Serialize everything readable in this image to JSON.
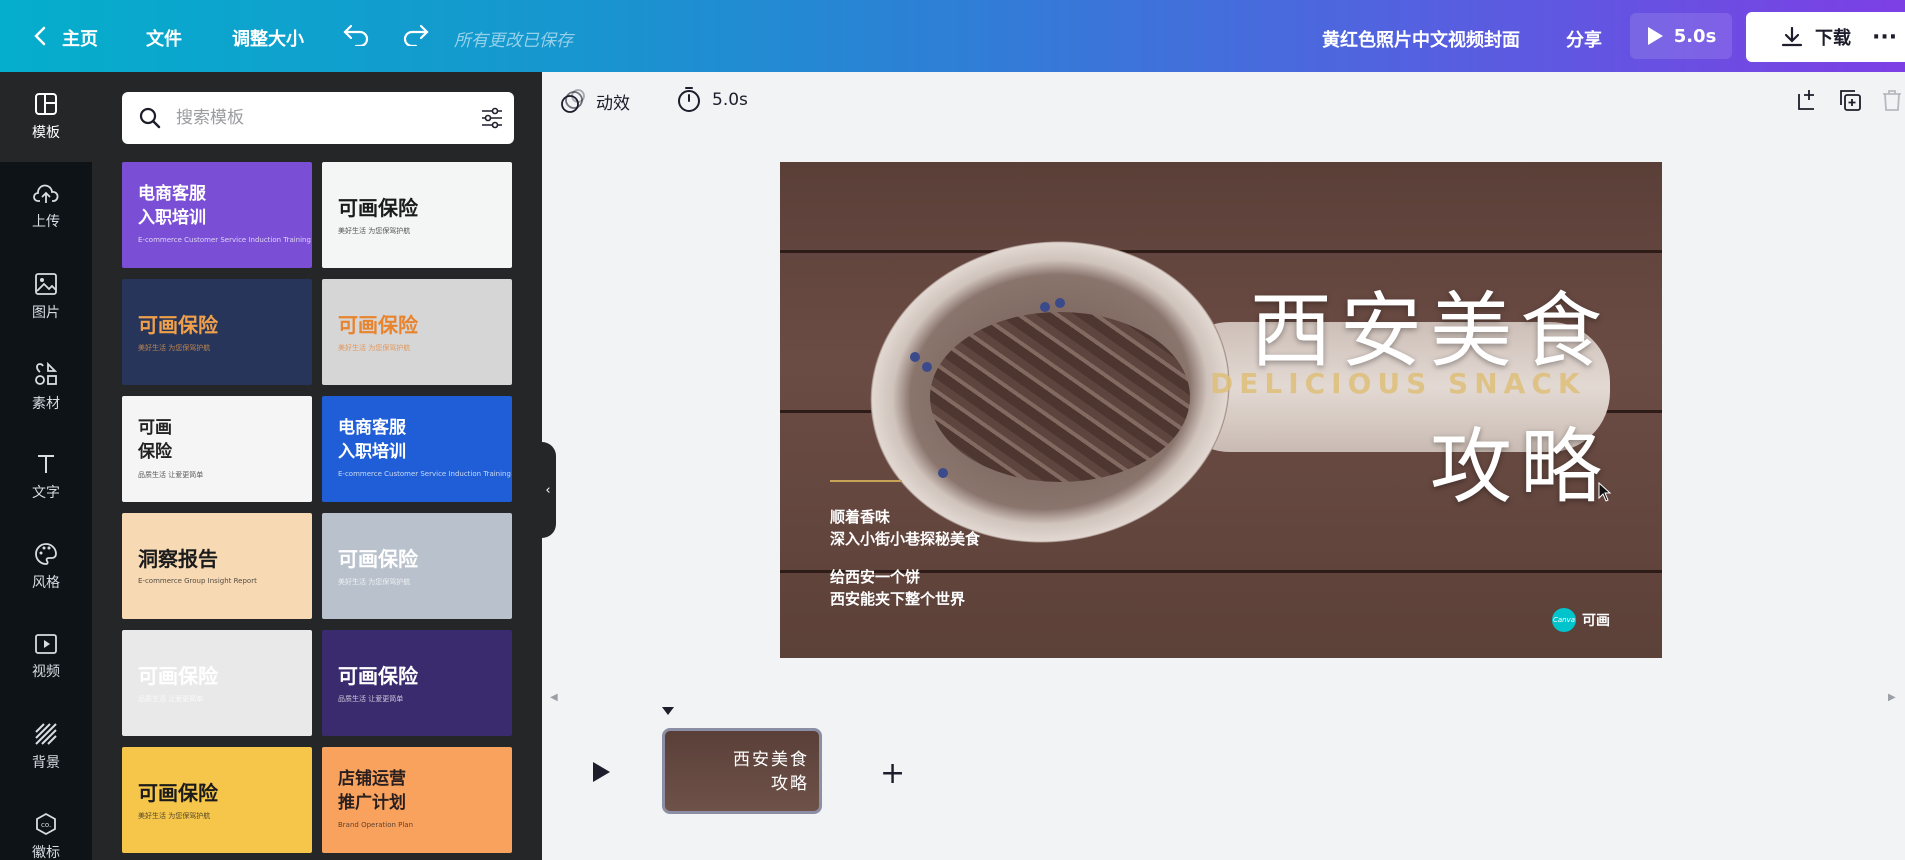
{
  "topbar": {
    "home": "主页",
    "file": "文件",
    "resize": "调整大小",
    "saved_status": "所有更改已保存",
    "doc_title": "黄红色照片中文视频封面",
    "share": "分享",
    "play_duration": "5.0s",
    "download": "下载"
  },
  "rail": {
    "items": [
      {
        "label": "模板",
        "icon": "template-icon"
      },
      {
        "label": "上传",
        "icon": "upload-icon"
      },
      {
        "label": "图片",
        "icon": "photo-icon"
      },
      {
        "label": "素材",
        "icon": "elements-icon"
      },
      {
        "label": "文字",
        "icon": "text-icon"
      },
      {
        "label": "风格",
        "icon": "palette-icon"
      },
      {
        "label": "视频",
        "icon": "video-icon"
      },
      {
        "label": "背景",
        "icon": "background-icon"
      },
      {
        "label": "徽标",
        "icon": "logo-icon"
      }
    ]
  },
  "panel": {
    "search_placeholder": "搜索模板",
    "templates": [
      {
        "title": "电商客服\n入职培训",
        "subtitle": "E-commerce Customer Service Induction Training",
        "bg": "#7a4fd6",
        "fg": "#ffffff"
      },
      {
        "title": "可画保险",
        "subtitle": "美好生活 为您保驾护航",
        "bg": "#f4f5f5",
        "fg": "#1b1b1b"
      },
      {
        "title": "可画保险",
        "subtitle": "美好生活 为您保驾护航",
        "bg": "#27355a",
        "fg": "#f0a04b"
      },
      {
        "title": "可画保险",
        "subtitle": "美好生活 为您保驾护航",
        "bg": "#d6d6d6",
        "fg": "#e8832e"
      },
      {
        "title": "可画\n保险",
        "subtitle": "品质生活 让爱更简单",
        "bg": "#f5f5f5",
        "fg": "#222222"
      },
      {
        "title": "电商客服\n入职培训",
        "subtitle": "E-commerce Customer Service Induction Training",
        "bg": "#1f5ed6",
        "fg": "#ffffff"
      },
      {
        "title": "洞察报告",
        "subtitle": "E-commerce Group Insight Report",
        "bg": "#f7d9b4",
        "fg": "#1b1b1b"
      },
      {
        "title": "可画保险",
        "subtitle": "美好生活 为您保驾护航",
        "bg": "#b9c2cc",
        "fg": "#ffffff"
      },
      {
        "title": "可画保险",
        "subtitle": "品质生活 让爱更简单",
        "bg": "#e9e9e9",
        "fg": "#ffffff"
      },
      {
        "title": "可画保险",
        "subtitle": "品质生活 让爱更简单",
        "bg": "#3a2a6e",
        "fg": "#ffffff"
      },
      {
        "title": "可画保险",
        "subtitle": "美好生活 为您保驾护航",
        "bg": "#f6c64a",
        "fg": "#1b1b1b"
      },
      {
        "title": "店铺运营\n推广计划",
        "subtitle": "Brand Operation Plan",
        "bg": "#f9a25d",
        "fg": "#2a1f1f"
      }
    ]
  },
  "editor": {
    "animate": "动效",
    "duration": "5.0s"
  },
  "canvas": {
    "title_line1": "西安美食",
    "subtitle_en": "DELICIOUS SNACK",
    "title_line2": "攻略",
    "text1_line1": "顺着香味",
    "text1_line2": "深入小街小巷探秘美食",
    "text2_line1": "给西安一个饼",
    "text2_line2": "西安能夹下整个世界",
    "logo_text": "可画",
    "logo_badge": "Canva"
  },
  "timeline": {
    "thumb_line1": "西安美食",
    "thumb_line2": "攻略"
  }
}
